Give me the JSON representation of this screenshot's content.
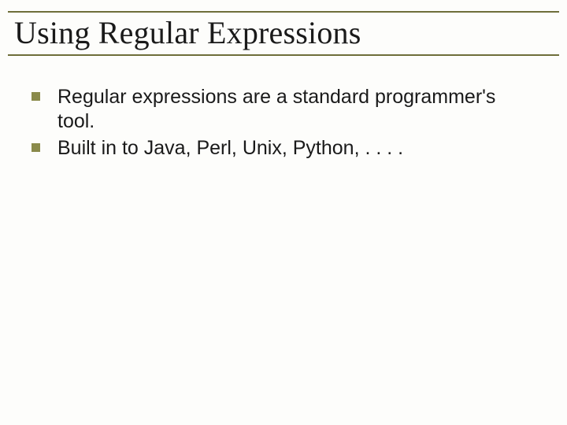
{
  "title": "Using Regular Expressions",
  "bullets": [
    "Regular expressions are a standard programmer's tool.",
    "Built in to Java, Perl, Unix, Python, . . . ."
  ]
}
